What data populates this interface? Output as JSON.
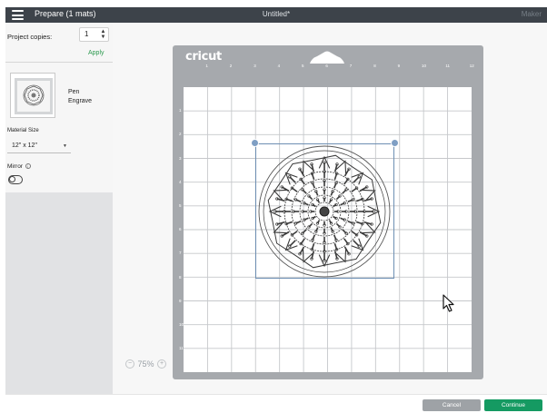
{
  "topbar": {
    "title": "Prepare (1 mats)",
    "document_title": "Untitled*",
    "maker_label": "Maker",
    "menu_icon": "hamburger-icon",
    "bg_color": "#3d434a"
  },
  "left_panel": {
    "copies_label": "Project copies:",
    "copies_value": "1",
    "apply_label": "Apply",
    "mat_label_line1": "Pen",
    "mat_label_line2": "Engrave",
    "material_size_label": "Material Size",
    "material_size_value": "12\" x 12\"",
    "mirror_label": "Mirror",
    "mirror_on": false,
    "accent_color": "#2d9a4f"
  },
  "canvas": {
    "mat_logo": "cricut",
    "top_ticks": [
      "1",
      "2",
      "3",
      "4",
      "5",
      "6",
      "7",
      "8",
      "9",
      "10",
      "11",
      "12"
    ],
    "left_ticks": [
      "1",
      "2",
      "3",
      "4",
      "5",
      "6",
      "7",
      "8",
      "9",
      "10",
      "11"
    ],
    "zoom_minus": "−",
    "zoom_value": "75%",
    "zoom_plus": "+"
  },
  "bottom_bar": {
    "cancel_label": "Cancel",
    "continue_label": "Continue",
    "continue_color": "#159a62"
  }
}
